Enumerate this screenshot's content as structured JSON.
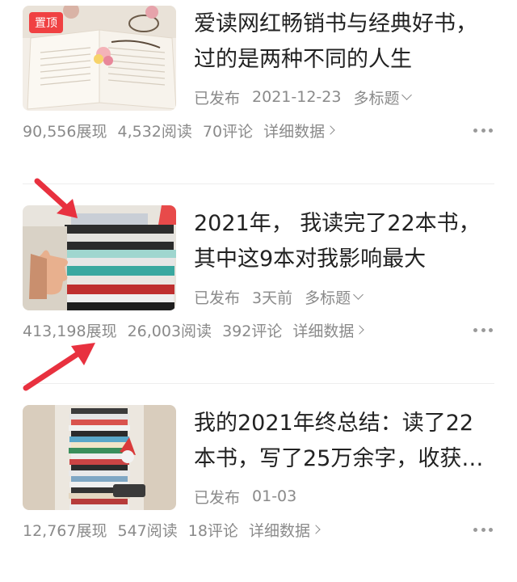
{
  "articles": [
    {
      "badge": "置顶",
      "title": "爱读网红畅销书与经典好书，过的是两种不同的人生",
      "status": "已发布",
      "date": "2021-12-23",
      "tag": "多标题",
      "impressions": "90,556展现",
      "reads": "4,532阅读",
      "comments": "70评论",
      "detail": "详细数据"
    },
    {
      "title": "2021年， 我读完了22本书，其中这9本对我影响最大",
      "status": "已发布",
      "date": "3天前",
      "tag": "多标题",
      "impressions": "413,198展现",
      "reads": "26,003阅读",
      "comments": "392评论",
      "detail": "详细数据"
    },
    {
      "title": "我的2021年终总结：读了22本书，写了25万余字，收获…",
      "status": "已发布",
      "date": "01-03",
      "impressions": "12,767展现",
      "reads": "547阅读",
      "comments": "18评论",
      "detail": "详细数据"
    }
  ],
  "colors": {
    "accent_red": "#f04142",
    "arrow_red": "#e8313f",
    "meta_gray": "#8a8a8a"
  }
}
